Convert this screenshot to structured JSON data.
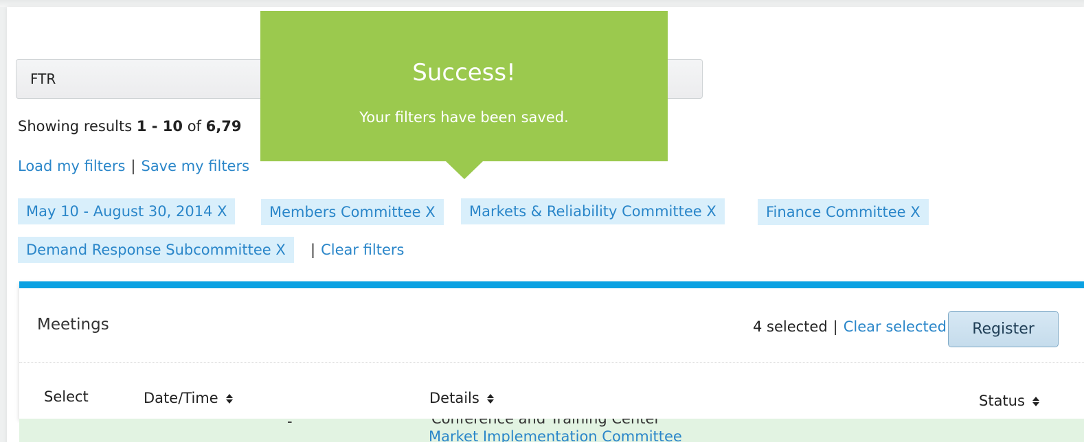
{
  "search": {
    "value": "FTR"
  },
  "results": {
    "prefix": "Showing results ",
    "range": "1 - 10",
    "of": " of ",
    "total": "6,79"
  },
  "filter_links": {
    "load": "Load my filters",
    "separator": "|",
    "save": "Save my filters"
  },
  "chips": [
    {
      "label": "May 10 - August 30, 2014 X"
    },
    {
      "label": "Members Committee X"
    },
    {
      "label": "Markets & Reliability Committee X"
    },
    {
      "label": "Finance Committee X"
    },
    {
      "label": "Demand Response Subcommittee X"
    }
  ],
  "clear_filters": {
    "separator": "|",
    "label": "Clear filters"
  },
  "toast": {
    "title": "Success!",
    "message": "Your filters have been saved.",
    "background": "#9bc94e"
  },
  "panel": {
    "title": "Meetings",
    "selected_text": "4 selected",
    "separator": "|",
    "clear_selected": "Clear selected",
    "register_label": "Register",
    "accent": "#0aa1e2"
  },
  "table": {
    "headers": {
      "select": "Select",
      "datetime": "Date/Time",
      "details": "Details",
      "status": "Status"
    }
  },
  "peek_row": {
    "text_top": "Conference and Training Center",
    "link": "Market Implementation Committee"
  },
  "colors": {
    "link": "#2a86c9",
    "chip_bg": "#d9effb"
  }
}
